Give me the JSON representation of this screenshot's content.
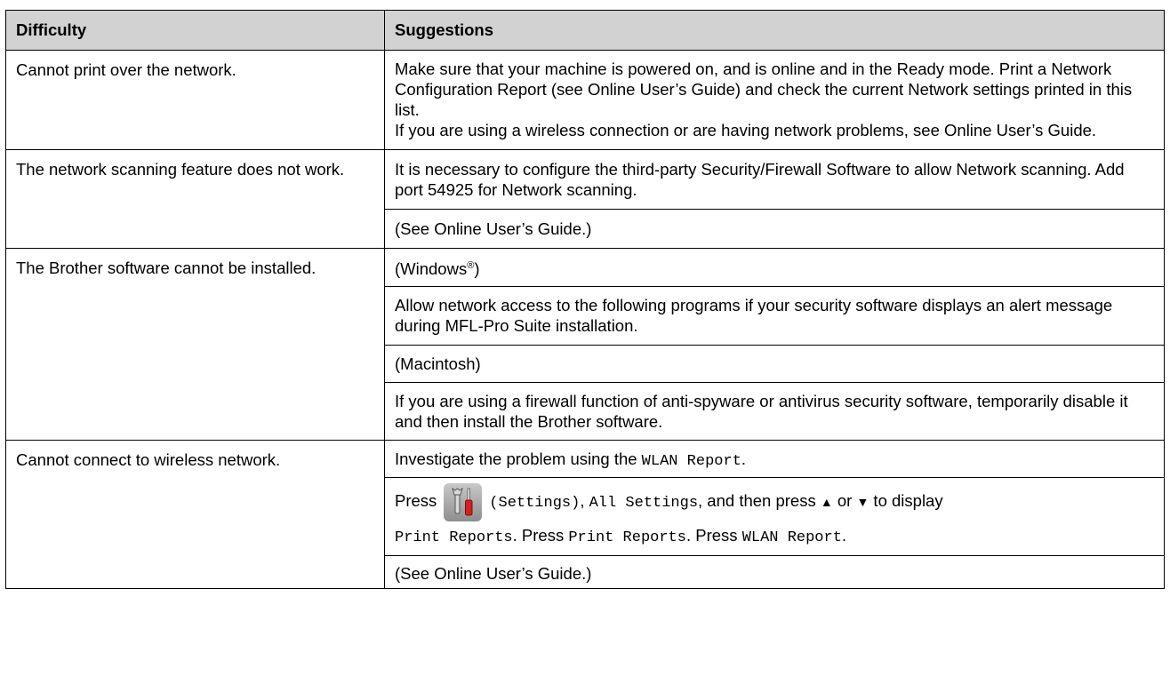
{
  "table": {
    "headers": {
      "difficulty": "Difficulty",
      "suggestions": "Suggestions"
    },
    "rows": [
      {
        "difficulty": "Cannot print over the network.",
        "s1": "Make sure that your machine is powered on, and is online and in the Ready mode. Print a Network Configuration Report (see Online User’s Guide) and check the current Network settings printed in this list.",
        "s2": "If you are using a wireless connection or are having network problems, see Online User’s Guide."
      },
      {
        "difficulty": "The network scanning feature does not work.",
        "s1": "It is necessary to configure the third-party Security/Firewall Software to allow Network scanning. Add port 54925 for Network scanning.",
        "s2": "(See Online User’s Guide.)"
      },
      {
        "difficulty": "The Brother software cannot be installed.",
        "windows_pre": "(Windows",
        "windows_sup": "®",
        "windows_post": ")",
        "s2": "Allow network access to the following programs if your security software displays an alert message during MFL-Pro Suite installation.",
        "s3": "(Macintosh)",
        "s4": "If you are using a firewall function of anti-spyware or antivirus security software, temporarily disable it and then install the Brother software."
      },
      {
        "difficulty": "Cannot connect to wireless network.",
        "s1_pre": "Investigate the problem using the ",
        "s1_mono": "WLAN Report",
        "s1_post": ".",
        "press": "Press",
        "settings_mono": "(Settings)",
        "comma1": ", ",
        "all_settings_mono": "All Settings",
        "and_then": ", and then press ",
        "up_arrow": "▲",
        "or": " or ",
        "down_arrow": "▼",
        "to_display": " to display",
        "print_reports_mono": "Print Reports",
        "press2": ". Press ",
        "print_reports_mono2": "Print Reports",
        "press3": ". Press ",
        "wlan_report_mono": "WLAN Report",
        "period": ".",
        "s4": "(See Online User’s Guide.)"
      }
    ]
  }
}
